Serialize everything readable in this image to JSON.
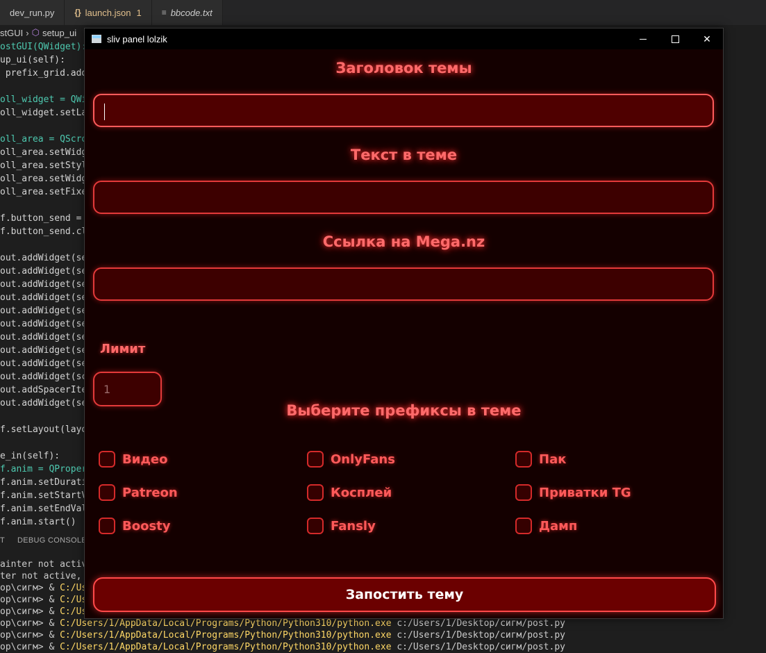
{
  "editor": {
    "tabs": [
      {
        "label": "dev_run.py"
      },
      {
        "label": "launch.json",
        "icon": "{}",
        "badge": "1"
      },
      {
        "label": "bbcode.txt"
      }
    ],
    "breadcrumb": [
      "stGUI",
      "setup_ui"
    ],
    "code_lines": [
      "ostGUI(QWidget):",
      "up_ui(self):",
      " prefix_grid.add",
      "",
      "oll_widget = QWi",
      "oll_widget.setLa",
      "",
      "oll_area = QScro",
      "oll_area.setWidg",
      "oll_area.setStyl",
      "oll_area.setWidg",
      "oll_area.setFixe",
      "",
      "f.button_send =",
      "f.button_send.cl",
      "",
      "out.addWidget(se",
      "out.addWidget(se",
      "out.addWidget(se",
      "out.addWidget(se",
      "out.addWidget(se",
      "out.addWidget(se",
      "out.addWidget(se",
      "out.addWidget(se",
      "out.addWidget(se",
      "out.addWidget(sc",
      "out.addSpacerIte",
      "out.addWidget(se",
      "",
      "f.setLayout(layo",
      "",
      "e_in(self):",
      "f.anim = QProper",
      "f.anim.setDurati",
      "f.anim.setStartV",
      "f.anim.setEndVal",
      "f.anim.start()"
    ],
    "panel_tabs": [
      "T",
      "DEBUG CONSOLE"
    ],
    "terminal": {
      "lines": [
        {
          "prefix": "ainter not active",
          "path": "",
          "suffix": ""
        },
        {
          "prefix": "ter not active, ab",
          "path": "",
          "suffix": ""
        },
        {
          "prefix": "op\\сигм> & ",
          "path": "C:/User",
          "suffix": ""
        },
        {
          "prefix": "op\\сигм> & ",
          "path": "C:/User",
          "suffix": ""
        },
        {
          "prefix": "op\\сигм> & ",
          "path": "C:/User",
          "suffix": ""
        },
        {
          "prefix": "op\\сигм> & ",
          "path": "C:/Users/1/AppData/Local/Programs/Python/Python310/python.exe",
          "suffix": " c:/Users/1/Desktop/сигм/post.py"
        },
        {
          "prefix": "op\\сигм> & ",
          "path": "C:/Users/1/AppData/Local/Programs/Python/Python310/python.exe",
          "suffix": " c:/Users/1/Desktop/сигм/post.py"
        },
        {
          "prefix": "op\\сигм> & ",
          "path": "C:/Users/1/AppData/Local/Programs/Python/Python310/python.exe",
          "suffix": " c:/Users/1/Desktop/сигм/post.py"
        }
      ]
    }
  },
  "window": {
    "title": "sliv panel lolzik",
    "close_glyph": "✕"
  },
  "form": {
    "title_heading": "Заголовок темы",
    "title_value": "",
    "text_heading": "Текст в теме",
    "text_value": "",
    "mega_heading": "Ссылка на Mega.nz",
    "mega_value": "",
    "limit_label": "Лимит",
    "limit_value": "1",
    "prefixes_heading": "Выберите префиксы в теме",
    "prefixes": [
      {
        "label": "Видео",
        "checked": false
      },
      {
        "label": "OnlyFans",
        "checked": false
      },
      {
        "label": "Пак",
        "checked": false
      },
      {
        "label": "Patreon",
        "checked": false
      },
      {
        "label": "Косплей",
        "checked": false
      },
      {
        "label": "Приватки TG",
        "checked": false
      },
      {
        "label": "Boosty",
        "checked": false
      },
      {
        "label": "Fansly",
        "checked": false
      },
      {
        "label": "Дамп",
        "checked": false
      }
    ],
    "submit_label": "Запостить тему"
  },
  "colors": {
    "accent": "#ff5a5a",
    "field_bg": "#3d0000",
    "window_bg": "#140000",
    "button_bg": "#6b0000"
  }
}
